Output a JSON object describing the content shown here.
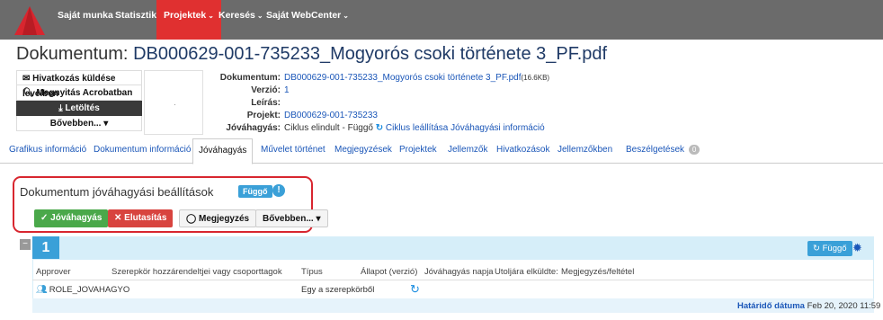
{
  "nav": {
    "items": [
      "Saját munka",
      "Statisztika",
      "Projektek",
      "Keresés",
      "Saját WebCenter"
    ],
    "active_index": 2
  },
  "document": {
    "title_prefix": "Dokumentum:",
    "title_name": "DB000629-001-735233_Mogyorós csoki története 3_PF.pdf"
  },
  "actions": {
    "send_reference": "Hivatkozás küldése levélben",
    "open_acrobat": "Megnyitás Acrobatban",
    "download": "Letöltés",
    "more": "Bővebben..."
  },
  "thumbnail": {
    "marker": "·"
  },
  "meta": {
    "document_label": "Dokumentum:",
    "document_value": "DB000629-001-735233_Mogyorós csoki története 3_PF.pdf",
    "document_size": "(16.6KB)",
    "version_label": "Verzió:",
    "version_value": "1",
    "description_label": "Leírás:",
    "project_label": "Projekt:",
    "project_value": "DB000629-001-735233",
    "approval_label": "Jóváhagyás:",
    "approval_status": "Ciklus elindult - Függő",
    "approval_stop": "Ciklus leállítása",
    "approval_info": "Jóváhagyási információ"
  },
  "tabs": [
    "Grafikus információ",
    "Dokumentum információ",
    "Jóváhagyás",
    "Művelet történet",
    "Megjegyzések",
    "Projektek",
    "Jellemzők",
    "Hivatkozások",
    "Jellemzőkben",
    "Beszélgetések"
  ],
  "tabs_active_index": 2,
  "discussions_count": "0",
  "approval_settings": {
    "title": "Dokumentum jóváhagyási beállítások",
    "status": "Függő",
    "approve": "Jóváhagyás",
    "reject": "Elutasítás",
    "comment": "Megjegyzés",
    "more": "Bővebben..."
  },
  "stage": {
    "number": "1",
    "status_button": "Függő",
    "columns": [
      "Approver",
      "Szerepkör hozzárendeltjei vagy csoporttagok",
      "Típus",
      "Állapot (verzió)",
      "Jóváhagyás napja",
      "Utoljára elküldte:",
      "Megjegyzés/feltétel"
    ],
    "rows": [
      {
        "approver": "ROLE_JOVAHAGYO",
        "type": "Egy a szerepkörből"
      }
    ],
    "deadline_label": "Határidő dátuma",
    "deadline_value": "Feb 20, 2020 11:59"
  },
  "colors": {
    "nav_bg": "#6b6b6b",
    "nav_active": "#e03030",
    "accent": "#3aa0d8",
    "link": "#1a56b8",
    "approve": "#4aa84a",
    "reject": "#d8443f",
    "highlight": "#d8262f"
  }
}
